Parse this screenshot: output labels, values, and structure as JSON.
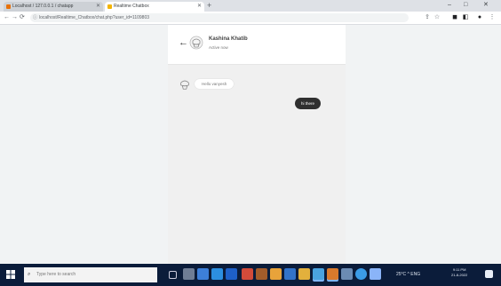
{
  "browser": {
    "tabs": [
      {
        "label": "Localhost / 127.0.0.1 / chatapp",
        "favicon_color": "#e8710a"
      },
      {
        "label": "Realtime Chatbox",
        "favicon_color": "#f4b400"
      }
    ],
    "new_tab_symbol": "+",
    "window_controls": {
      "minimize": "–",
      "maximize": "□",
      "close": "✕"
    },
    "address": "localhost/Realtime_Chatbox/chat.php?user_id=1109803",
    "lock_symbol": "ⓘ"
  },
  "chat": {
    "contact_name": "Kashina Khatib",
    "contact_status": "Active now",
    "back_symbol": "←",
    "incoming_message": "Hello vanyesh",
    "outgoing_message": "hi there"
  },
  "taskbar": {
    "search_placeholder": "Type here to search",
    "tray_text": "25°C ^ ENG",
    "time": "9:11 PM",
    "date": "21-8-2022"
  },
  "colors": {
    "outgoing_bubble": "#2f2f2f",
    "taskbar": "#0b1c3a"
  }
}
